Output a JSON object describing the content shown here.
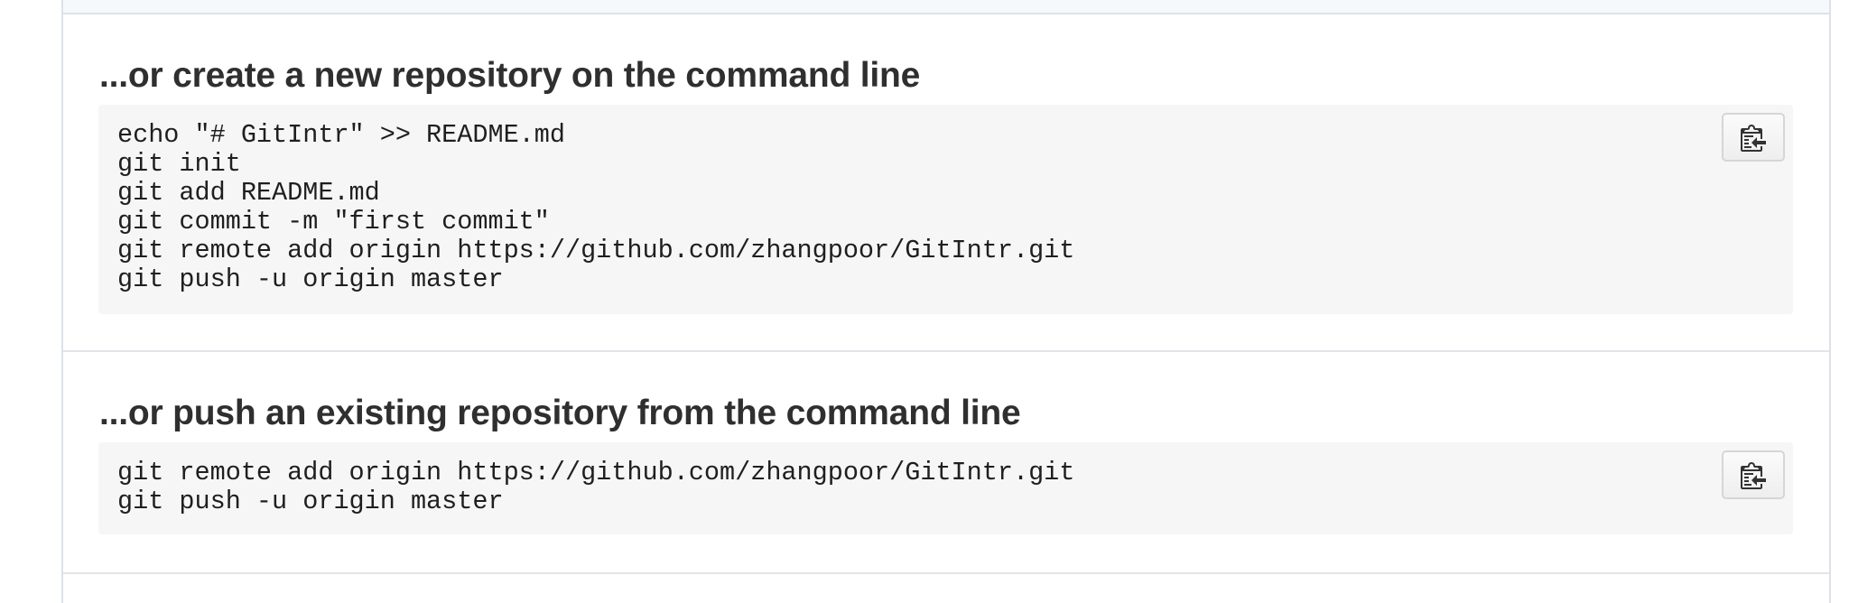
{
  "sections": {
    "create": {
      "heading": "...or create a new repository on the command line",
      "code_lines": [
        "echo \"# GitIntr\" >> README.md",
        "git init",
        "git add README.md",
        "git commit -m \"first commit\"",
        "git remote add origin https://github.com/zhangpoor/GitIntr.git",
        "git push -u origin master"
      ],
      "copy_icon": "clippy-icon"
    },
    "push": {
      "heading": "...or push an existing repository from the command line",
      "code_lines": [
        "git remote add origin https://github.com/zhangpoor/GitIntr.git",
        "git push -u origin master"
      ],
      "copy_icon": "clippy-icon"
    }
  },
  "colors": {
    "heading": "#2f2f2f",
    "code_text": "#1f1f1f",
    "code_background": "#f6f6f6",
    "divider": "#e1e4e8"
  }
}
